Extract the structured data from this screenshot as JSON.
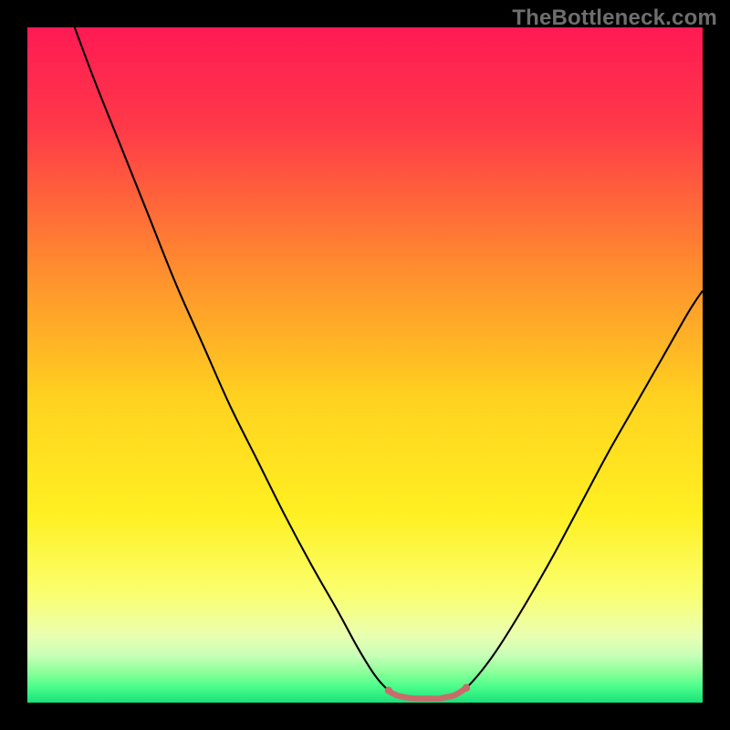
{
  "watermark": "TheBottleneck.com",
  "chart_data": {
    "type": "line",
    "title": "",
    "xlabel": "",
    "ylabel": "",
    "xlim": [
      0,
      100
    ],
    "ylim": [
      0,
      100
    ],
    "grid": false,
    "background_gradient_stops": [
      {
        "offset": 0.0,
        "color": "#ff1a54"
      },
      {
        "offset": 0.15,
        "color": "#ff3a48"
      },
      {
        "offset": 0.35,
        "color": "#ff8a2f"
      },
      {
        "offset": 0.55,
        "color": "#ffd21f"
      },
      {
        "offset": 0.72,
        "color": "#fff022"
      },
      {
        "offset": 0.84,
        "color": "#faff70"
      },
      {
        "offset": 0.9,
        "color": "#eaffb0"
      },
      {
        "offset": 0.93,
        "color": "#c8ffb8"
      },
      {
        "offset": 0.955,
        "color": "#8cff9a"
      },
      {
        "offset": 0.975,
        "color": "#4fff8c"
      },
      {
        "offset": 1.0,
        "color": "#18e07a"
      }
    ],
    "series": [
      {
        "name": "main-v-curve",
        "stroke": "#000000",
        "stroke_width": 2.1,
        "points": [
          {
            "x": 7.0,
            "y": 100.0
          },
          {
            "x": 10.0,
            "y": 92.0
          },
          {
            "x": 14.0,
            "y": 82.0
          },
          {
            "x": 18.0,
            "y": 72.0
          },
          {
            "x": 22.0,
            "y": 62.0
          },
          {
            "x": 26.0,
            "y": 53.0
          },
          {
            "x": 30.0,
            "y": 44.0
          },
          {
            "x": 34.0,
            "y": 36.0
          },
          {
            "x": 38.0,
            "y": 28.0
          },
          {
            "x": 42.0,
            "y": 20.5
          },
          {
            "x": 46.0,
            "y": 13.5
          },
          {
            "x": 49.0,
            "y": 8.0
          },
          {
            "x": 51.5,
            "y": 4.0
          },
          {
            "x": 53.5,
            "y": 1.8
          },
          {
            "x": 55.0,
            "y": 1.0
          },
          {
            "x": 58.0,
            "y": 0.6
          },
          {
            "x": 61.0,
            "y": 0.6
          },
          {
            "x": 63.0,
            "y": 1.0
          },
          {
            "x": 65.0,
            "y": 2.2
          },
          {
            "x": 67.5,
            "y": 5.0
          },
          {
            "x": 70.0,
            "y": 8.5
          },
          {
            "x": 74.0,
            "y": 15.0
          },
          {
            "x": 78.0,
            "y": 22.0
          },
          {
            "x": 82.0,
            "y": 29.5
          },
          {
            "x": 86.0,
            "y": 37.0
          },
          {
            "x": 90.0,
            "y": 44.0
          },
          {
            "x": 94.0,
            "y": 51.0
          },
          {
            "x": 98.0,
            "y": 58.0
          },
          {
            "x": 100.0,
            "y": 61.0
          }
        ]
      },
      {
        "name": "trough-highlight",
        "stroke": "#c96b6b",
        "stroke_width": 6.5,
        "linecap": "round",
        "dot_radius": 4.2,
        "points": [
          {
            "x": 53.5,
            "y": 1.8
          },
          {
            "x": 54.0,
            "y": 1.4
          },
          {
            "x": 55.0,
            "y": 1.0
          },
          {
            "x": 56.5,
            "y": 0.7
          },
          {
            "x": 58.0,
            "y": 0.6
          },
          {
            "x": 59.5,
            "y": 0.6
          },
          {
            "x": 61.0,
            "y": 0.6
          },
          {
            "x": 62.0,
            "y": 0.8
          },
          {
            "x": 63.0,
            "y": 1.0
          },
          {
            "x": 64.0,
            "y": 1.5
          },
          {
            "x": 65.0,
            "y": 2.2
          }
        ]
      }
    ]
  }
}
